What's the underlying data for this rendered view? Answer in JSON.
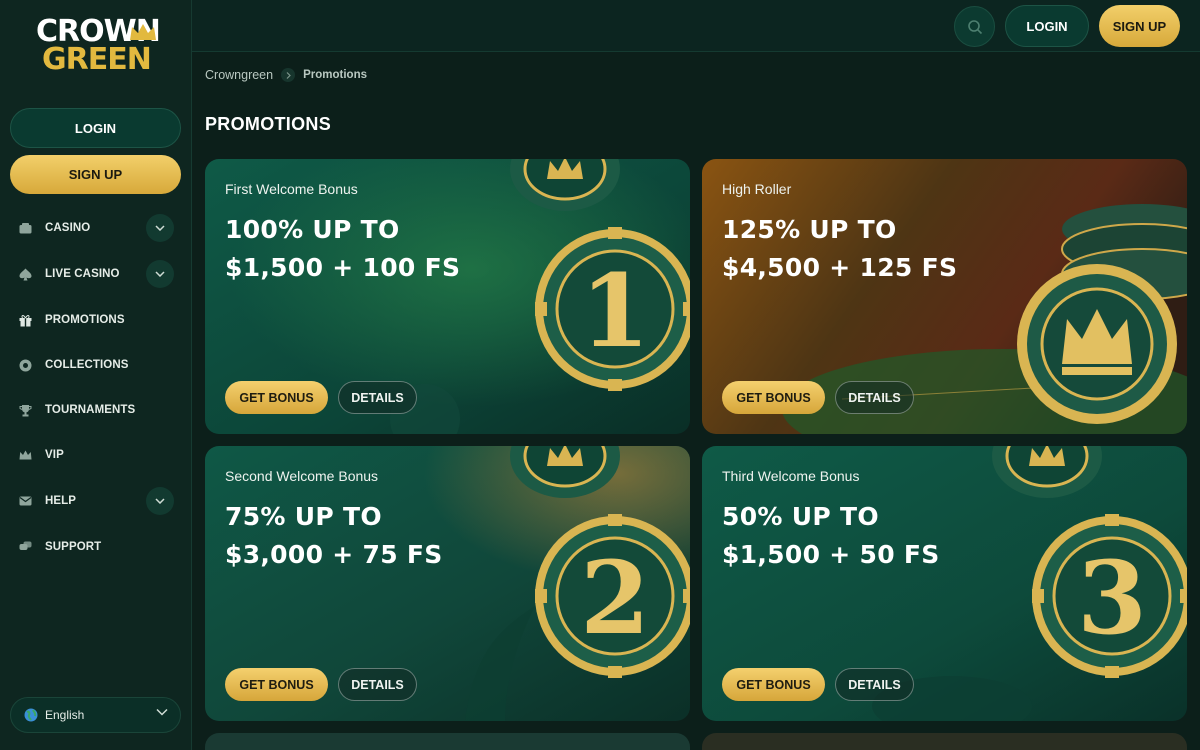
{
  "brand": {
    "line1": "CROWN",
    "line2": "GREEN"
  },
  "sidebar": {
    "login_label": "LOGIN",
    "signup_label": "SIGN UP",
    "items": [
      {
        "label": "CASINO",
        "icon": "casino-icon",
        "expandable": true
      },
      {
        "label": "LIVE CASINO",
        "icon": "spade-icon",
        "expandable": true
      },
      {
        "label": "PROMOTIONS",
        "icon": "gift-icon",
        "expandable": false
      },
      {
        "label": "COLLECTIONS",
        "icon": "chip-icon",
        "expandable": false
      },
      {
        "label": "TOURNAMENTS",
        "icon": "trophy-icon",
        "expandable": false
      },
      {
        "label": "VIP",
        "icon": "crown-icon",
        "expandable": false
      },
      {
        "label": "HELP",
        "icon": "mail-icon",
        "expandable": true
      },
      {
        "label": "SUPPORT",
        "icon": "chat-icon",
        "expandable": false
      }
    ],
    "language": "English"
  },
  "header": {
    "login_label": "LOGIN",
    "signup_label": "SIGN UP"
  },
  "breadcrumb": {
    "home": "Crowngreen",
    "current": "Promotions"
  },
  "page_title": "PROMOTIONS",
  "promotions": [
    {
      "subtitle": "First Welcome Bonus",
      "line1": "100% UP TO",
      "line2": "$1,500 + 100 FS",
      "chip_label": "1",
      "cta": "GET BONUS",
      "details": "DETAILS"
    },
    {
      "subtitle": "High Roller",
      "line1": "125% UP TO",
      "line2": "$4,500 + 125 FS",
      "chip_label": "crown",
      "cta": "GET BONUS",
      "details": "DETAILS"
    },
    {
      "subtitle": "Second Welcome Bonus",
      "line1": "75% UP TO",
      "line2": "$3,000 + 75 FS",
      "chip_label": "2",
      "cta": "GET BONUS",
      "details": "DETAILS"
    },
    {
      "subtitle": "Third Welcome Bonus",
      "line1": "50% UP TO",
      "line2": "$1,500 + 50 FS",
      "chip_label": "3",
      "cta": "GET BONUS",
      "details": "DETAILS"
    }
  ],
  "colors": {
    "background": "#0c1f1a",
    "sidebar": "#0e2620",
    "gold": "#e2b93f",
    "button_dark": "#0a3a30",
    "card_green": "#145a48",
    "card_amber": "#8a5a16"
  }
}
